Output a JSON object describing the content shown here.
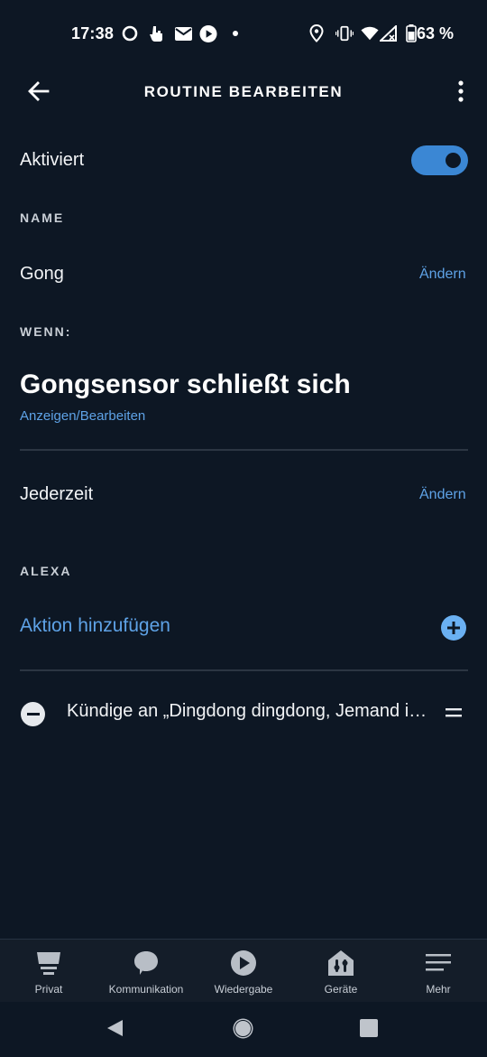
{
  "status_bar": {
    "time": "17:38",
    "battery": "63 %",
    "left_icons": [
      "circle-icon",
      "hand-icon",
      "mail-icon",
      "play-circle-icon",
      "dot-icon"
    ],
    "right_icons": [
      "location-icon",
      "vibrate-icon",
      "wifi-icon",
      "signal-icon",
      "battery-icon"
    ]
  },
  "app_bar": {
    "title": "ROUTINE BEARBEITEN",
    "back_icon": "arrow-left-icon",
    "more_icon": "more-vertical-icon"
  },
  "enabled": {
    "label": "Aktiviert",
    "on": true,
    "accent": "#3b87d4"
  },
  "name_section": {
    "label": "NAME",
    "value": "Gong",
    "edit_link": "Ändern"
  },
  "when_section": {
    "label": "WENN:",
    "trigger": "Gongsensor schließt sich",
    "view_edit_link": "Anzeigen/Bearbeiten",
    "schedule": "Jederzeit",
    "schedule_edit_link": "Ändern"
  },
  "alexa_section": {
    "label": "ALEXA",
    "add_action": "Aktion hinzufügen",
    "actions": [
      {
        "text": "Kündige an „Dingdong dingdong, Jemand ist an der Tür“"
      }
    ]
  },
  "bottom_nav": {
    "items": [
      {
        "label": "Privat",
        "icon": "home-icon"
      },
      {
        "label": "Kommunikation",
        "icon": "chat-bubble-icon"
      },
      {
        "label": "Wiedergabe",
        "icon": "play-icon"
      },
      {
        "label": "Geräte",
        "icon": "devices-icon"
      },
      {
        "label": "Mehr",
        "icon": "menu-icon"
      }
    ]
  },
  "colors": {
    "background": "#0d1724",
    "link": "#5ea2e6",
    "nav_background": "#141d29"
  }
}
